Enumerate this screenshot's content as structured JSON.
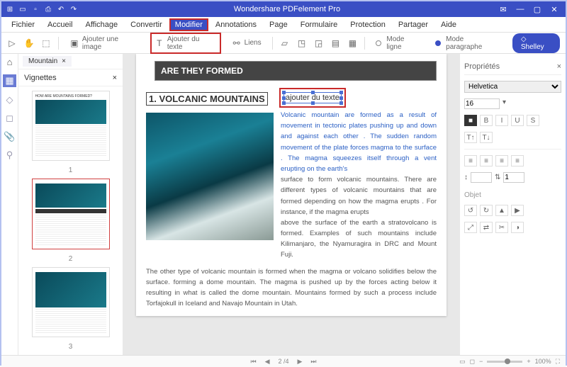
{
  "titlebar": {
    "title": "Wondershare PDFelement Pro"
  },
  "menu": {
    "items": [
      "Fichier",
      "Accueil",
      "Affichage",
      "Convertir",
      "Modifier",
      "Annotations",
      "Page",
      "Formulaire",
      "Protection",
      "Partager",
      "Aide"
    ],
    "active": "Modifier"
  },
  "toolbar": {
    "add_image": "Ajouter une image",
    "add_text": "Ajouter du texte",
    "links": "Liens",
    "mode_line": "Mode ligne",
    "mode_para": "Mode paragraphe",
    "user": "Shelley"
  },
  "tabs": {
    "doc": "Mountain"
  },
  "panels": {
    "thumbs": "Vignettes",
    "props": "Propriétés"
  },
  "thumbnails": {
    "label1": "1",
    "label2": "2",
    "label3": "3",
    "caption": "HOW ARE MOUNTAINS FORMED?"
  },
  "document": {
    "banner": "ARE THEY FORMED",
    "heading": "1. VOLCANIC MOUNTAINS",
    "add_text_box": "ajouter du texte",
    "para1": "Volcanic mountain are formed as a result of movement in tectonic plates pushing up and down and against each other . The sudden random movement of the plate forces magma to the surface . The magma squeezes itself through a vent erupting on the earth's",
    "para2": "surface to form volcanic mountains. There are different types of volcanic mountains that are formed depending on how the magma erupts . For instance, if the magma erupts",
    "para3": "above the surface of the earth a stratovolcano is formed. Examples of such mountains include Kilimanjaro, the Nyamuragira in DRC and Mount Fuji.",
    "para4": "The other type of volcanic mountain is formed when the magma or volcano solidifies below the surface. forming a dome mountain. The magma is pushed up by the forces acting below it resulting in what is called the dome mountain. Mountains formed by such a process include Torfajokull in Iceland and Navajo Mountain in Utah."
  },
  "properties": {
    "font": "Helvetica",
    "size": "16",
    "object": "Objet",
    "spacing": "1"
  },
  "status": {
    "page": "2 /4",
    "zoom": "100%"
  }
}
